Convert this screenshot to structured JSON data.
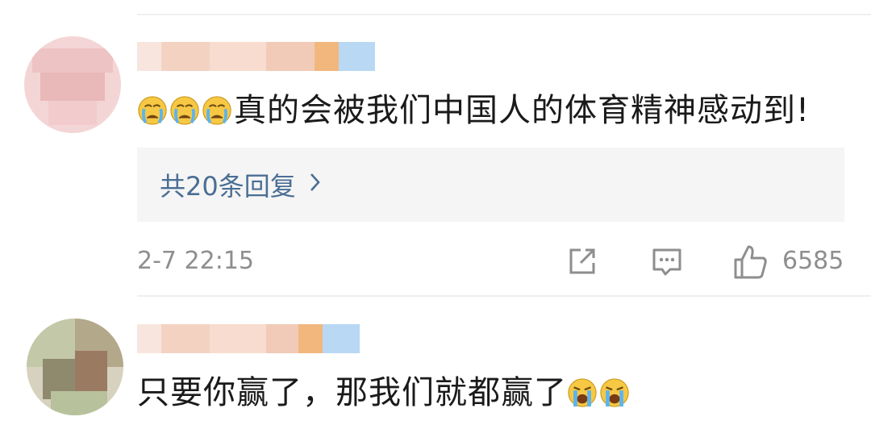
{
  "comments": [
    {
      "text": "真的会被我们中国人的体育精神感动到!",
      "emoji": [
        "crying-face",
        "crying-face",
        "crying-face"
      ],
      "replies_label": "共20条回复",
      "timestamp": "2-7 22:15",
      "like_count": "6585"
    },
    {
      "text": "只要你赢了，那我们就都赢了",
      "emoji": [
        "loudly-crying-face",
        "loudly-crying-face"
      ]
    }
  ],
  "colors": {
    "link": "#4a6e94",
    "meta_gray": "#8e8e8e",
    "reply_bg": "#f5f5f5"
  },
  "icons": {
    "share": "share-icon",
    "comment": "comment-icon",
    "like": "thumbs-up-icon",
    "chevron": "chevron-right-icon"
  }
}
